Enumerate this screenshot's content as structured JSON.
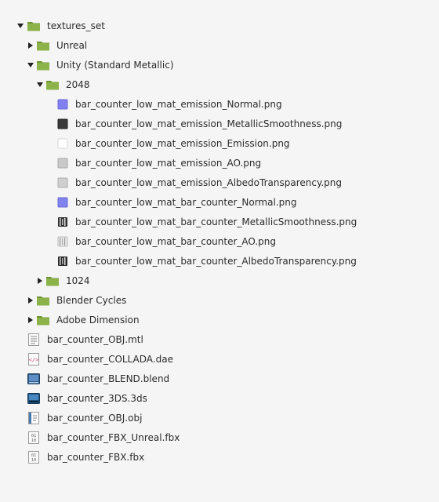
{
  "tree": {
    "root": {
      "label": "textures_set",
      "icon": "folder-icon",
      "state": "expanded"
    },
    "unreal": {
      "label": "Unreal",
      "icon": "folder-icon",
      "state": "collapsed"
    },
    "unity": {
      "label": "Unity (Standard Metallic)",
      "icon": "folder-icon",
      "state": "expanded"
    },
    "unity_2048": {
      "label": "2048",
      "icon": "folder-icon",
      "state": "expanded"
    },
    "files_2048": [
      {
        "label": "bar_counter_low_mat_emission_Normal.png",
        "icon": "normal-map-icon",
        "color": "#8080f0"
      },
      {
        "label": "bar_counter_low_mat_emission_MetallicSmoothness.png",
        "icon": "dark-map-icon",
        "color": "#3a3a3a"
      },
      {
        "label": "bar_counter_low_mat_emission_Emission.png",
        "icon": "white-map-icon",
        "color": "#ffffff"
      },
      {
        "label": "bar_counter_low_mat_emission_AO.png",
        "icon": "grey-map-icon",
        "color": "#c9c9c9"
      },
      {
        "label": "bar_counter_low_mat_emission_AlbedoTransparency.png",
        "icon": "grey-map-icon",
        "color": "#cfcfcf"
      },
      {
        "label": "bar_counter_low_mat_bar_counter_Normal.png",
        "icon": "normal-map-icon",
        "color": "#8282ee"
      },
      {
        "label": "bar_counter_low_mat_bar_counter_MetallicSmoothness.png",
        "icon": "striped-dark-map-icon",
        "color": "#2e2e2e"
      },
      {
        "label": "bar_counter_low_mat_bar_counter_AO.png",
        "icon": "striped-light-map-icon",
        "color": "#d8d8d8"
      },
      {
        "label": "bar_counter_low_mat_bar_counter_AlbedoTransparency.png",
        "icon": "striped-dark-map-icon",
        "color": "#2a2a2a"
      }
    ],
    "unity_1024": {
      "label": "1024",
      "icon": "folder-icon",
      "state": "collapsed"
    },
    "blender": {
      "label": "Blender Cycles",
      "icon": "folder-icon",
      "state": "collapsed"
    },
    "adobe": {
      "label": "Adobe Dimension",
      "icon": "folder-icon",
      "state": "collapsed"
    },
    "root_files": [
      {
        "label": "bar_counter_OBJ.mtl",
        "icon": "text-file-icon"
      },
      {
        "label": "bar_counter_COLLADA.dae",
        "icon": "code-file-icon"
      },
      {
        "label": "bar_counter_BLEND.blend",
        "icon": "blender-file-icon"
      },
      {
        "label": "bar_counter_3DS.3ds",
        "icon": "image-3d-file-icon"
      },
      {
        "label": "bar_counter_OBJ.obj",
        "icon": "obj-file-icon"
      },
      {
        "label": "bar_counter_FBX_Unreal.fbx",
        "icon": "binary-file-icon"
      },
      {
        "label": "bar_counter_FBX.fbx",
        "icon": "binary-file-icon"
      }
    ]
  },
  "colors": {
    "background": "#f5f5f5",
    "folder_body": "#8cb24a",
    "folder_tab": "#6e9433",
    "text": "#2b2b2b"
  }
}
